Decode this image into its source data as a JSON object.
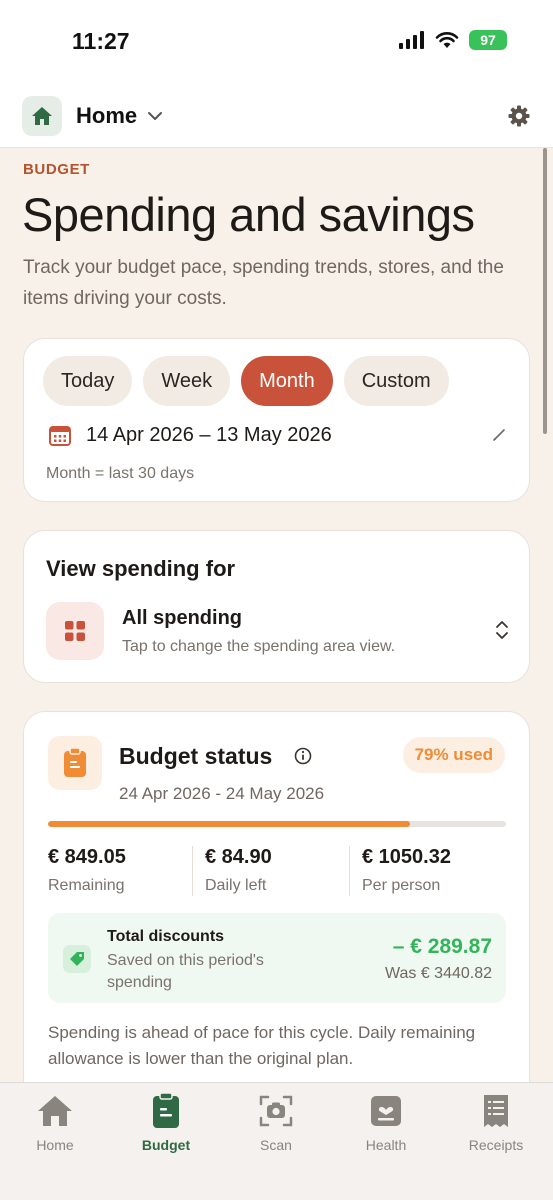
{
  "status": {
    "time": "11:27",
    "battery": "97"
  },
  "header": {
    "title": "Home"
  },
  "intro": {
    "eyebrow": "BUDGET",
    "title": "Spending and savings",
    "subtitle": "Track your budget pace, spending trends, stores, and the items driving your costs."
  },
  "period": {
    "chips": [
      "Today",
      "Week",
      "Month",
      "Custom"
    ],
    "active": "Month",
    "range": "14 Apr 2026 – 13 May 2026",
    "note": "Month = last 30 days"
  },
  "view": {
    "title": "View spending for",
    "selection": "All spending",
    "hint": "Tap to change the spending area view."
  },
  "budget": {
    "title": "Budget status",
    "used_badge": "79% used",
    "used_fraction": 0.79,
    "range": "24 Apr 2026 - 24 May 2026",
    "stats": [
      {
        "value": "€ 849.05",
        "label": "Remaining"
      },
      {
        "value": "€ 84.90",
        "label": "Daily left"
      },
      {
        "value": "€ 1050.32",
        "label": "Per person"
      }
    ],
    "discounts": {
      "title": "Total discounts",
      "desc": "Saved on this period's spending",
      "amount": "– € 289.87",
      "was": "Was € 3440.82"
    },
    "note": "Spending is ahead of pace for this cycle. Daily remaining allowance is lower than the original plan."
  },
  "tabs": [
    {
      "label": "Home",
      "icon": "home-icon"
    },
    {
      "label": "Budget",
      "icon": "clipboard-icon"
    },
    {
      "label": "Scan",
      "icon": "camera-icon"
    },
    {
      "label": "Health",
      "icon": "health-icon"
    },
    {
      "label": "Receipts",
      "icon": "receipt-icon"
    }
  ],
  "active_tab": "Budget",
  "colors": {
    "accent": "#c9533a",
    "budget_orange": "#ef8c35",
    "discount_green": "#33b45a",
    "nav_active": "#2f6a45"
  }
}
